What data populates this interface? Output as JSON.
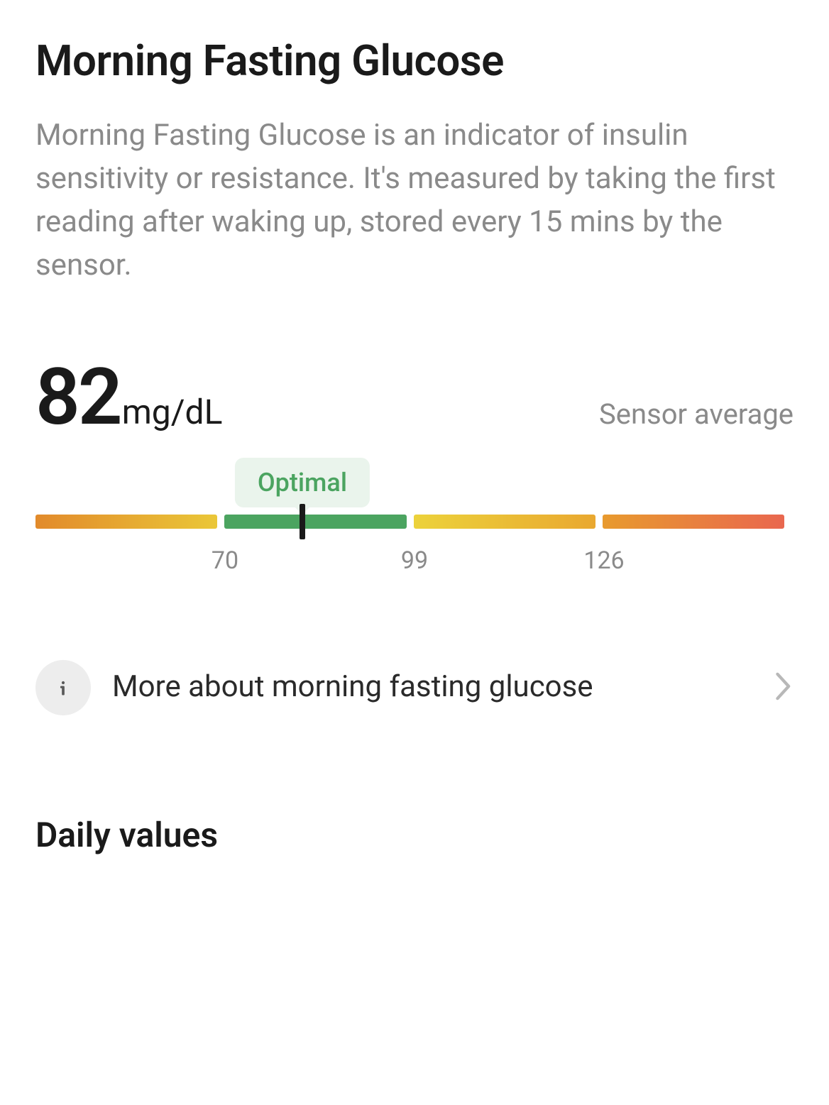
{
  "title": "Morning Fasting Glucose",
  "description": "Morning Fasting Glucose is an indicator of insulin sensitivity or resistance. It's measured by taking the first reading after waking up, stored every 15 mins by the sensor.",
  "reading": {
    "value": "82",
    "unit": "mg/dL",
    "label": "Sensor average"
  },
  "gauge": {
    "status": "Optimal",
    "marker_percent": 35.2,
    "ticks": [
      {
        "label": "70",
        "percent": 25
      },
      {
        "label": "99",
        "percent": 50
      },
      {
        "label": "126",
        "percent": 75
      }
    ]
  },
  "more_link": {
    "text": "More about morning fasting glucose"
  },
  "section": {
    "daily_values": "Daily values"
  }
}
